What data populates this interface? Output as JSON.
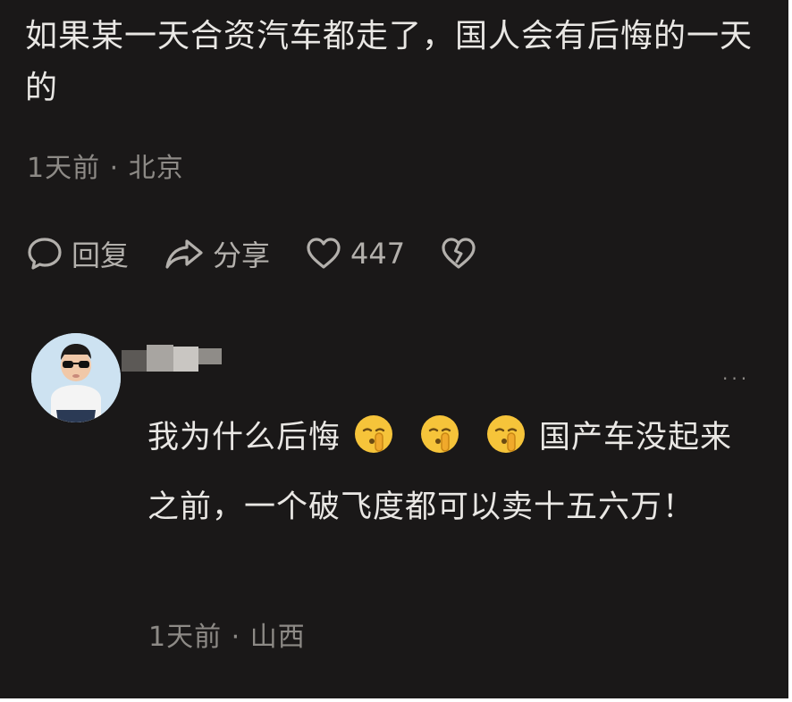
{
  "comment": {
    "text": "如果某一天合资汽车都走了，国人会有后悔的一天的",
    "time": "1天前",
    "location": "北京",
    "separator": " · ",
    "actions": {
      "reply_label": "回复",
      "share_label": "分享",
      "like_count": "447"
    }
  },
  "reply": {
    "text_before": "我为什么后悔",
    "text_after": "国产车没起来之前，一个破飞度都可以卖十五六万！",
    "emoji_count": 3,
    "time": "1天前",
    "location": "山西",
    "separator": " · ",
    "more_label": "···"
  },
  "colors": {
    "background": "#1a1818",
    "primary_text": "#e9e7e4",
    "secondary_text": "#8d8a86",
    "emoji_yellow": "#f6c43a"
  },
  "icons": [
    "comment-bubble-icon",
    "share-arrow-icon",
    "heart-icon",
    "broken-heart-icon",
    "more-dots-icon",
    "shush-face-emoji"
  ]
}
